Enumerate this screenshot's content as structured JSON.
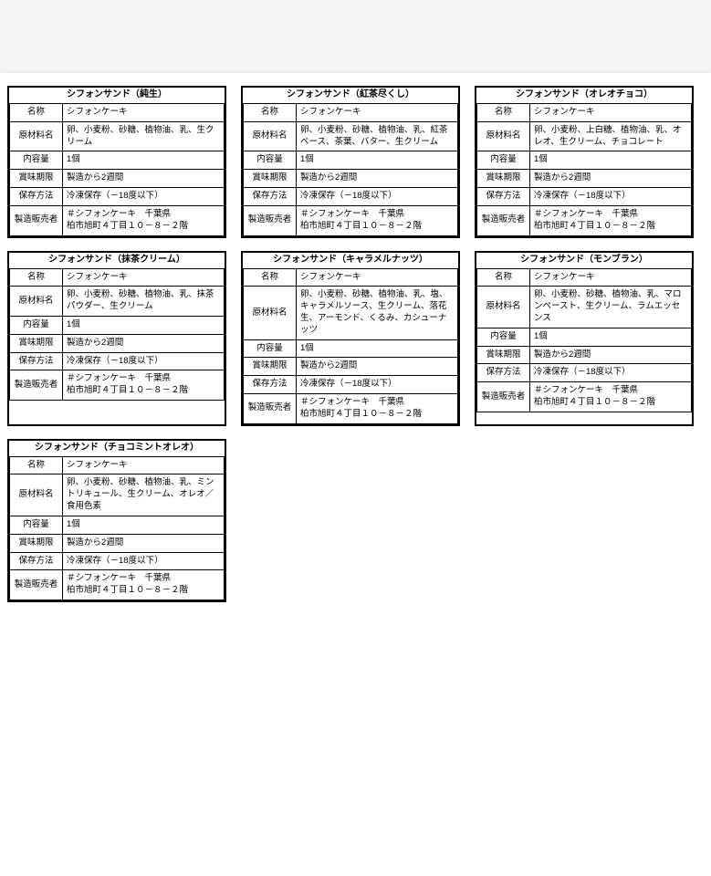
{
  "row_labels": {
    "name": "名称",
    "ingredients": "原材料名",
    "contents": "内容量",
    "best_before": "賞味期限",
    "storage": "保存方法",
    "seller": "製造販売者"
  },
  "common": {
    "cake_name": "シフォンケーキ",
    "contents_value": "1個",
    "best_before_value": "製造から2週間",
    "storage_value": "冷凍保存（－18度以下）",
    "seller_line1": "＃シフォンケーキ　千葉県",
    "seller_line2": "柏市旭町４丁目１０－８－２階"
  },
  "cards": [
    {
      "title": "シフォンサンド（純生）",
      "ingredients": "卵、小麦粉、砂糖、植物油、乳、生クリーム"
    },
    {
      "title": "シフォンサンド（紅茶尽くし）",
      "ingredients": "卵、小麦粉、砂糖、植物油、乳、紅茶ベース、茶葉、バター、生クリーム"
    },
    {
      "title": "シフォンサンド（オレオチョコ）",
      "ingredients": "卵、小麦粉、上白糖、植物油、乳、オレオ、生クリーム、チョコレート"
    },
    {
      "title": "シフォンサンド（抹茶クリーム）",
      "ingredients": "卵、小麦粉、砂糖、植物油、乳、抹茶パウダー、生クリーム"
    },
    {
      "title": "シフォンサンド（キャラメルナッツ）",
      "ingredients": "卵、小麦粉、砂糖、植物油、乳、塩、キャラメルソース、生クリーム、落花生、アーモンド、くるみ、カシューナッツ"
    },
    {
      "title": "シフォンサンド（モンブラン）",
      "ingredients": "卵、小麦粉、砂糖、植物油、乳、マロンペースト、生クリーム、ラムエッセンス"
    },
    {
      "title": "シフォンサンド（チョコミントオレオ）",
      "ingredients": "卵、小麦粉、砂糖、植物油、乳、ミントリキュール、生クリーム、オレオ／食用色素"
    }
  ]
}
